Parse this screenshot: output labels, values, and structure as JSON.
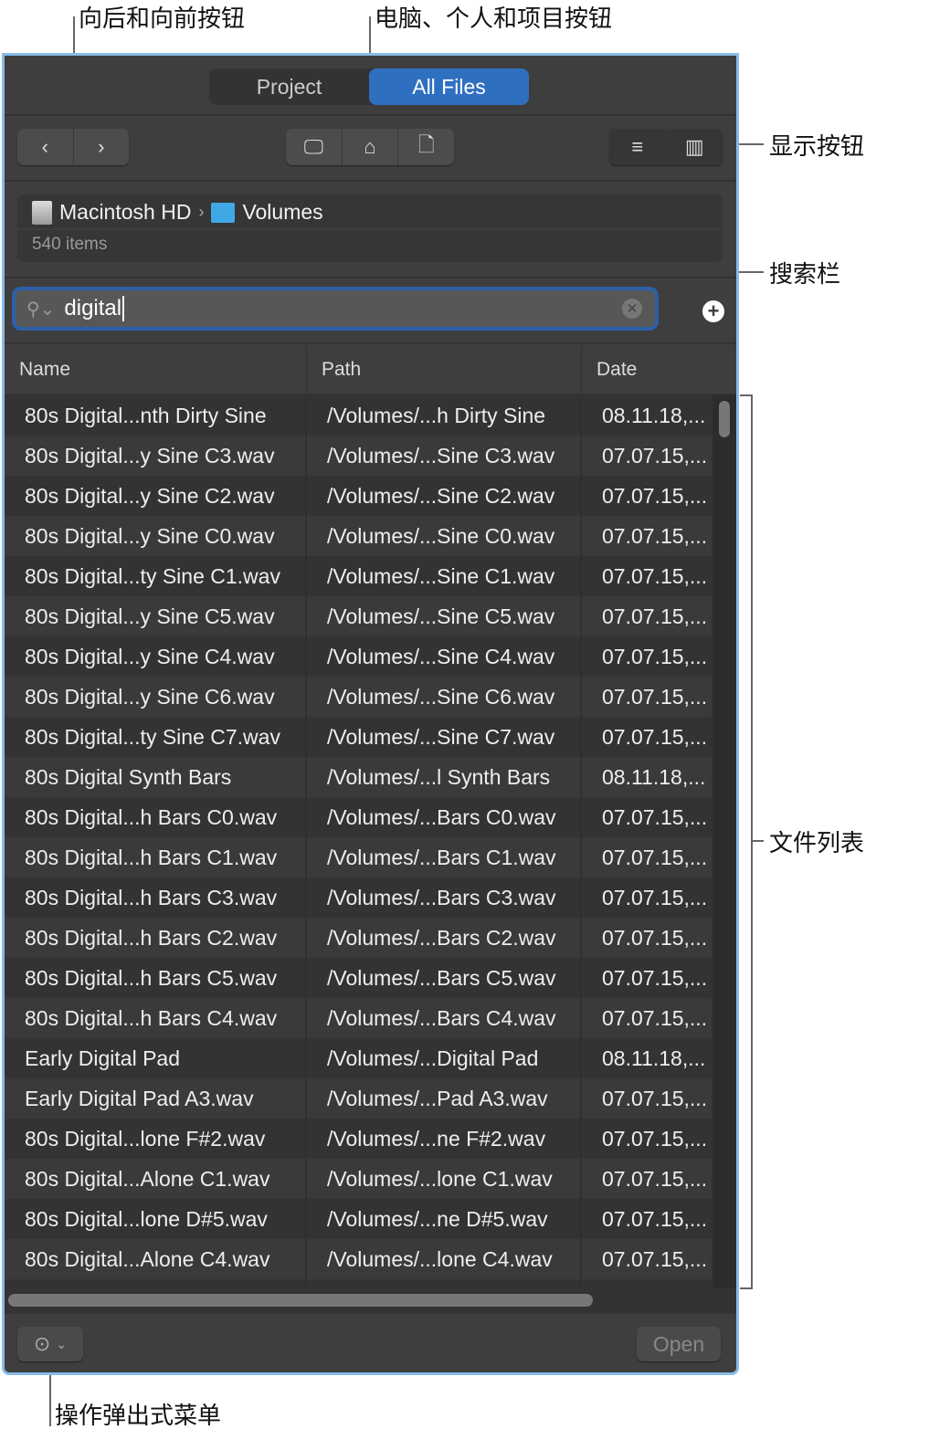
{
  "callouts": {
    "nav": "向后和向前按钮",
    "locations": "电脑、个人和项目按钮",
    "view": "显示按钮",
    "search": "搜索栏",
    "list": "文件列表",
    "action": "操作弹出式菜单"
  },
  "tabs": [
    {
      "label": "Project",
      "active": false
    },
    {
      "label": "All Files",
      "active": true
    }
  ],
  "breadcrumb": {
    "disk": "Macintosh HD",
    "sep": "›",
    "folder": "Volumes",
    "count": "540 items"
  },
  "search": {
    "value": "digital"
  },
  "columns": [
    "Name",
    "Path",
    "Date"
  ],
  "rows": [
    [
      "80s Digital...nth Dirty Sine",
      "/Volumes/...h Dirty Sine",
      "08.11.18,..."
    ],
    [
      "80s Digital...y Sine C3.wav",
      "/Volumes/...Sine C3.wav",
      "07.07.15,..."
    ],
    [
      "80s Digital...y Sine C2.wav",
      "/Volumes/...Sine C2.wav",
      "07.07.15,..."
    ],
    [
      "80s Digital...y Sine C0.wav",
      "/Volumes/...Sine C0.wav",
      "07.07.15,..."
    ],
    [
      "80s Digital...ty Sine C1.wav",
      "/Volumes/...Sine C1.wav",
      "07.07.15,..."
    ],
    [
      "80s Digital...y Sine C5.wav",
      "/Volumes/...Sine C5.wav",
      "07.07.15,..."
    ],
    [
      "80s Digital...y Sine C4.wav",
      "/Volumes/...Sine C4.wav",
      "07.07.15,..."
    ],
    [
      "80s Digital...y Sine C6.wav",
      "/Volumes/...Sine C6.wav",
      "07.07.15,..."
    ],
    [
      "80s Digital...ty Sine C7.wav",
      "/Volumes/...Sine C7.wav",
      "07.07.15,..."
    ],
    [
      "80s Digital Synth Bars",
      "/Volumes/...l Synth Bars",
      "08.11.18,..."
    ],
    [
      "80s Digital...h Bars C0.wav",
      "/Volumes/...Bars C0.wav",
      "07.07.15,..."
    ],
    [
      "80s Digital...h Bars C1.wav",
      "/Volumes/...Bars C1.wav",
      "07.07.15,..."
    ],
    [
      "80s Digital...h Bars C3.wav",
      "/Volumes/...Bars C3.wav",
      "07.07.15,..."
    ],
    [
      "80s Digital...h Bars C2.wav",
      "/Volumes/...Bars C2.wav",
      "07.07.15,..."
    ],
    [
      "80s Digital...h Bars C5.wav",
      "/Volumes/...Bars C5.wav",
      "07.07.15,..."
    ],
    [
      "80s Digital...h Bars C4.wav",
      "/Volumes/...Bars C4.wav",
      "07.07.15,..."
    ],
    [
      "Early Digital Pad",
      "/Volumes/...Digital Pad",
      "08.11.18,..."
    ],
    [
      "Early Digital Pad A3.wav",
      "/Volumes/...Pad A3.wav",
      "07.07.15,..."
    ],
    [
      "80s Digital...lone F#2.wav",
      "/Volumes/...ne F#2.wav",
      "07.07.15,..."
    ],
    [
      "80s Digital...Alone C1.wav",
      "/Volumes/...lone C1.wav",
      "07.07.15,..."
    ],
    [
      "80s Digital...lone D#5.wav",
      "/Volumes/...ne D#5.wav",
      "07.07.15,..."
    ],
    [
      "80s Digital...Alone C4.wav",
      "/Volumes/...lone C4.wav",
      "07.07.15,..."
    ],
    [
      "",
      "",
      ""
    ]
  ],
  "footer": {
    "open": "Open"
  },
  "colors": {
    "accent": "#2f6fc0",
    "panel": "#3e3e3e",
    "frame": "#86bbe9"
  }
}
